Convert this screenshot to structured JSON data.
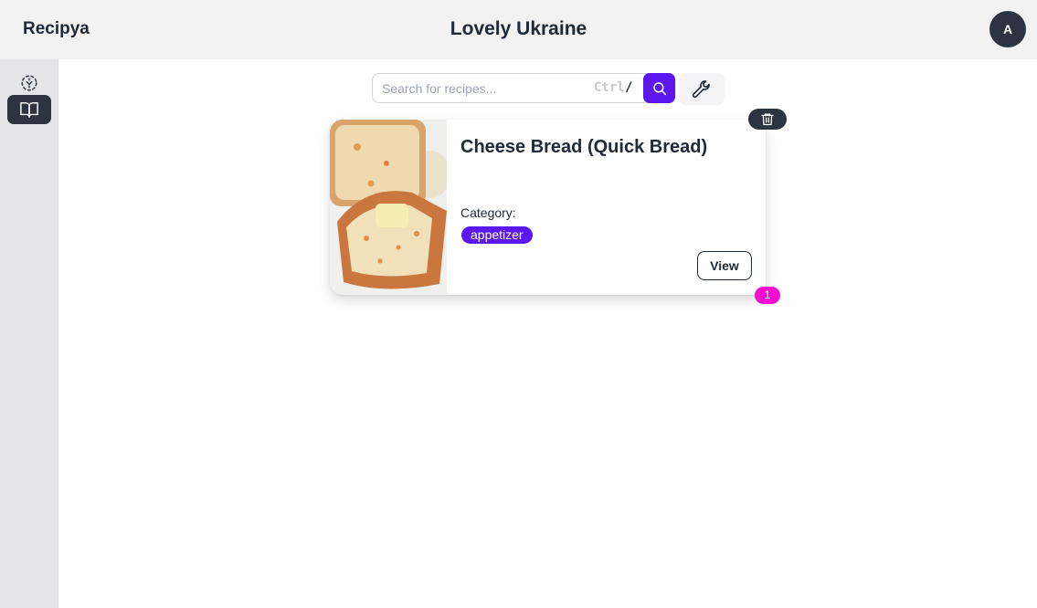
{
  "app": {
    "brand": "Recipya",
    "page_title": "Lovely Ukraine",
    "avatar_initial": "A"
  },
  "sidebar": {
    "items": [
      {
        "icon": "scan-icon",
        "active": false
      },
      {
        "icon": "book-open-icon",
        "active": true
      }
    ]
  },
  "search": {
    "placeholder": "Search for recipes...",
    "value": "",
    "shortcut_key": "Ctrl",
    "shortcut_char": "/"
  },
  "toolbar": {
    "search_icon": "search-icon",
    "settings_icon": "wrench-icon"
  },
  "recipes": [
    {
      "title": "Cheese Bread (Quick Bread)",
      "category_label": "Category:",
      "category": "appetizer",
      "view_label": "View",
      "count": "1"
    }
  ],
  "colors": {
    "accent": "#5a18ee",
    "dark": "#2b3440",
    "badge": "#f10ed1"
  }
}
